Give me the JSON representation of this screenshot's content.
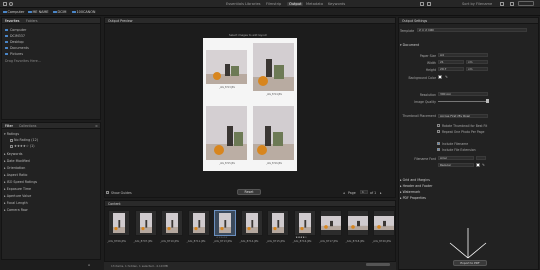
{
  "topbar": {
    "tabs": [
      "Essentials",
      "Libraries",
      "Filmstrip",
      "Output",
      "Metadata",
      "Keywords"
    ],
    "active_tab": "Output",
    "sort_label": "Sort by Filename"
  },
  "path": {
    "crumbs": [
      "Computer",
      "ME NAME",
      "DCIM",
      "100CANON"
    ]
  },
  "left": {
    "favorites_tab": "Favorites",
    "folders_tab": "Folders",
    "favorites": [
      "Computer",
      "DCIM337",
      "Desktop",
      "Documents",
      "Pictures"
    ],
    "drag_hint": "Drag Favorites Here...",
    "filter_tab": "Filter",
    "collections_tab": "Collections",
    "ratings_header": "Ratings",
    "ratings": [
      {
        "label": "No Rating",
        "count": "(12)"
      },
      {
        "label": "★★★★☆",
        "count": "(1)"
      }
    ],
    "filter_groups": [
      "Keywords",
      "Date Modified",
      "Orientation",
      "Aspect Ratio",
      "ISO Speed Ratings",
      "Exposure Time",
      "Aperture Value",
      "Focal Length",
      "Camera Raw"
    ]
  },
  "preview": {
    "header": "Output Preview",
    "page_hint": "Select images to add layout",
    "captions": [
      "_AIG_8713.JPG",
      "_AIG_8714.JPG",
      "_AIG_8715.JPG",
      "_AIG_8716.JPG"
    ],
    "show_guides": "Show Guides",
    "reset_label": "Reset",
    "page_label": "Page",
    "page_num": "1",
    "page_of": "of 1"
  },
  "filmstrip": {
    "header": "Content",
    "items": [
      {
        "label": "_AIG_8706.JPG",
        "stars": ""
      },
      {
        "label": "_AIG_8707.JPG",
        "stars": ""
      },
      {
        "label": "_AIG_8710.JPG",
        "stars": ""
      },
      {
        "label": "_AIG_8711.JPG",
        "stars": ""
      },
      {
        "label": "_AIG_8713.JPG",
        "stars": "☆☆☆☆☆"
      },
      {
        "label": "_AIG_8714.JPG",
        "stars": ""
      },
      {
        "label": "_AIG_8715.JPG",
        "stars": ""
      },
      {
        "label": "_AIG_8716.JPG",
        "stars": "★★★★☆"
      },
      {
        "label": "_AIG_8717.JPG",
        "stars": ""
      },
      {
        "label": "_AIG_8718.JPG",
        "stars": ""
      },
      {
        "label": "_AIG_8720.JPG",
        "stars": ""
      }
    ],
    "status": "13 items, 1 hidden, 1 selected - 4.10 MB"
  },
  "settings": {
    "header": "Output Settings",
    "template_label": "Template",
    "template_value": "2 × 2 (4R)",
    "document_header": "Document",
    "fields": [
      {
        "label": "Paper Size",
        "value": "A4"
      },
      {
        "label": "Width",
        "value": "21",
        "unit": "cm"
      },
      {
        "label": "Height",
        "value": "29.7",
        "unit": "cm"
      },
      {
        "label": "Background Color",
        "value": ""
      },
      {
        "label": "Resolution",
        "value": "300 ppi"
      },
      {
        "label": "Image Quality",
        "value": ""
      },
      {
        "label": "Thumbnail Placement",
        "value": "Across First (By Row)"
      }
    ],
    "checkboxes": [
      "Rotate Thumbnail for Best Fit",
      "Repeat One Photo Per Page",
      "Include Filename",
      "Include File Extension"
    ],
    "filename_font_label": "Filename Font",
    "filename_font": "Arial",
    "font_style": "Regular",
    "sections": [
      "Grid and Margins",
      "Header and Footer",
      "Watermark",
      "PDF Properties"
    ],
    "export_label": "Export to PDF"
  }
}
